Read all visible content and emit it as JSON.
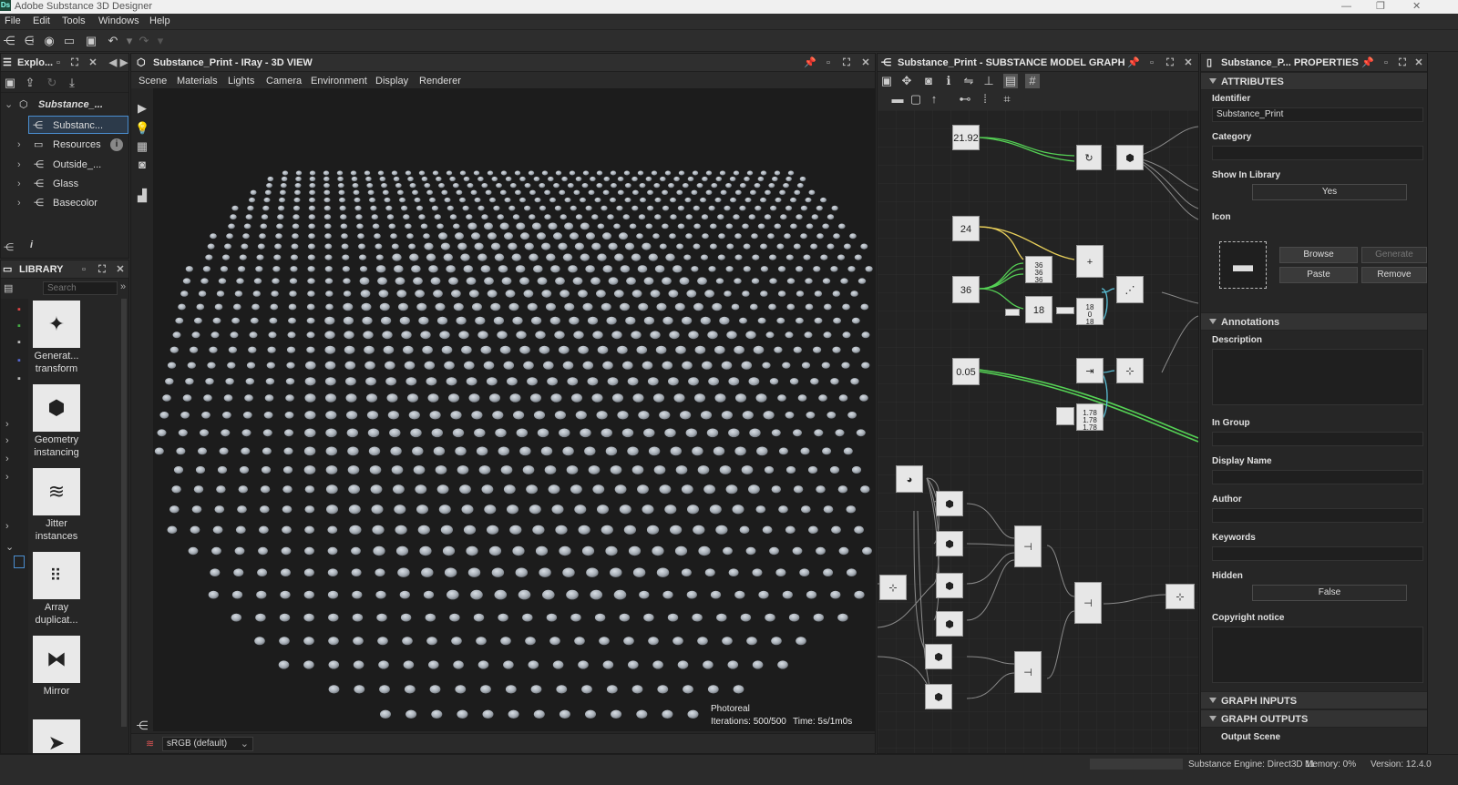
{
  "app": {
    "title": "Adobe Substance 3D Designer",
    "logo": "Ds"
  },
  "menu": [
    "File",
    "Edit",
    "Tools",
    "Windows",
    "Help"
  ],
  "explorer": {
    "title": "Explo...",
    "root": "Substance_...",
    "selected": "Substanc...",
    "items": [
      "Resources",
      "Outside_...",
      "Glass",
      "Basecolor"
    ]
  },
  "library": {
    "title": "LIBRARY",
    "search_placeholder": "Search",
    "items": [
      {
        "label": "Generat... transform"
      },
      {
        "label": "Geometry instancing"
      },
      {
        "label": "Jitter instances"
      },
      {
        "label": "Array duplicat..."
      },
      {
        "label": "Mirror"
      }
    ]
  },
  "view3d": {
    "title": "Substance_Print - IRay - 3D VIEW",
    "menu": [
      "Scene",
      "Materials",
      "Lights",
      "Camera",
      "Environment",
      "Display",
      "Renderer"
    ],
    "render_mode": "Photoreal",
    "iterations": "Iterations: 500/500",
    "time": "Time: 5s/1m0s",
    "colorspace": "sRGB (default)"
  },
  "graph": {
    "title": "Substance_Print - SUBSTANCE MODEL GRAPH",
    "values": {
      "v1": "21.92",
      "v2": "24",
      "v3": "36",
      "v4": "0.05",
      "v5": "18",
      "stack_a": [
        "36",
        "36",
        "36"
      ],
      "stack_b": [
        "18",
        "0",
        "18"
      ],
      "stack_c": [
        "1.78",
        "1.78",
        "1.78"
      ]
    }
  },
  "properties": {
    "title": "Substance_P... PROPERTIES",
    "sections": {
      "attributes": "ATTRIBUTES",
      "annotations": "Annotations",
      "graph_inputs": "GRAPH INPUTS",
      "graph_outputs": "GRAPH OUTPUTS"
    },
    "identifier_label": "Identifier",
    "identifier_value": "Substance_Print",
    "category_label": "Category",
    "show_in_library_label": "Show In Library",
    "show_in_library_value": "Yes",
    "icon_label": "Icon",
    "browse": "Browse",
    "generate": "Generate",
    "paste": "Paste",
    "remove": "Remove",
    "description_label": "Description",
    "in_group_label": "In Group",
    "display_name_label": "Display Name",
    "author_label": "Author",
    "keywords_label": "Keywords",
    "hidden_label": "Hidden",
    "hidden_value": "False",
    "copyright_label": "Copyright notice",
    "output_scene": "Output Scene"
  },
  "status": {
    "engine": "Substance Engine: Direct3D 11",
    "memory": "Memory: 0%",
    "version": "Version: 12.4.0"
  }
}
